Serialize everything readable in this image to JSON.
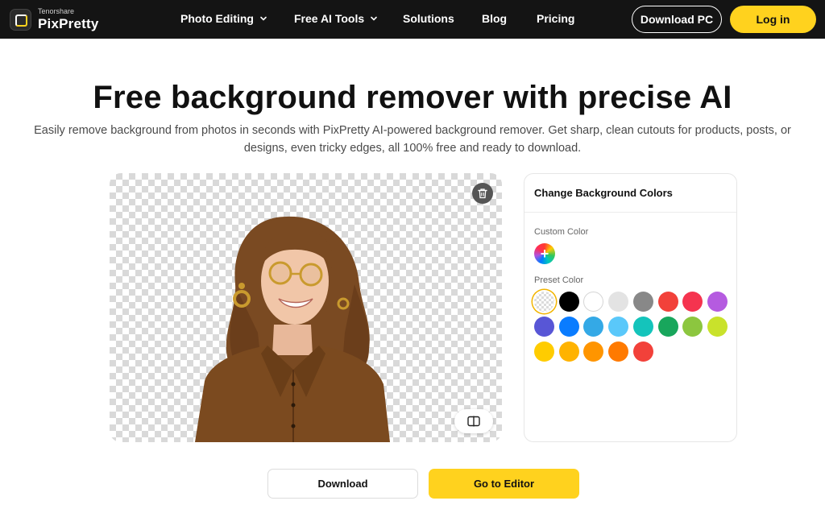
{
  "nav": {
    "brand_small": "Tenorshare",
    "brand_name": "PixPretty",
    "items": [
      {
        "label": "Photo Editing",
        "has_dropdown": true
      },
      {
        "label": "Free AI Tools",
        "has_dropdown": true
      },
      {
        "label": "Solutions",
        "has_dropdown": false
      },
      {
        "label": "Blog",
        "has_dropdown": false
      },
      {
        "label": "Pricing",
        "has_dropdown": false
      }
    ],
    "download_pc_label": "Download PC",
    "login_label": "Log in"
  },
  "hero": {
    "headline_highlight": "Free",
    "headline_rest": " background remover with precise AI",
    "subtitle": "Easily remove background from photos in seconds with PixPretty AI-powered background remover. Get sharp, clean cutouts for products, posts, or designs, even tricky edges, all 100% free and ready to download."
  },
  "preview": {
    "icons": [
      "trash-icon",
      "compare-icon"
    ]
  },
  "color_panel": {
    "title": "Change Background Colors",
    "custom_label": "Custom Color",
    "preset_label": "Preset Color",
    "custom_swatch_symbol": "+",
    "presets": [
      {
        "name": "transparent",
        "color": "transparent",
        "selected": true
      },
      {
        "name": "black",
        "color": "#000000"
      },
      {
        "name": "white",
        "color": "#ffffff"
      },
      {
        "name": "light-gray",
        "color": "#e3e3e3"
      },
      {
        "name": "gray",
        "color": "#888888"
      },
      {
        "name": "red",
        "color": "#f2413a"
      },
      {
        "name": "crimson",
        "color": "#f5344f"
      },
      {
        "name": "purple",
        "color": "#b55be0"
      },
      {
        "name": "indigo",
        "color": "#5856d6"
      },
      {
        "name": "blue",
        "color": "#0a7cff"
      },
      {
        "name": "sky-blue",
        "color": "#34a9e6"
      },
      {
        "name": "light-blue",
        "color": "#5ac8fa"
      },
      {
        "name": "teal",
        "color": "#14c4bb"
      },
      {
        "name": "green",
        "color": "#18a65c"
      },
      {
        "name": "lime-green",
        "color": "#8cc63f"
      },
      {
        "name": "yellow-green",
        "color": "#c9e22b"
      },
      {
        "name": "gold",
        "color": "#ffcc00"
      },
      {
        "name": "amber",
        "color": "#ffb300"
      },
      {
        "name": "orange",
        "color": "#ff9500"
      },
      {
        "name": "dark-orange",
        "color": "#ff7a00"
      },
      {
        "name": "red-2",
        "color": "#f2413a"
      }
    ]
  },
  "actions": {
    "download_label": "Download",
    "editor_label": "Go to Editor"
  },
  "colors": {
    "nav_bg": "#141414",
    "accent_yellow": "#ffd21e"
  }
}
